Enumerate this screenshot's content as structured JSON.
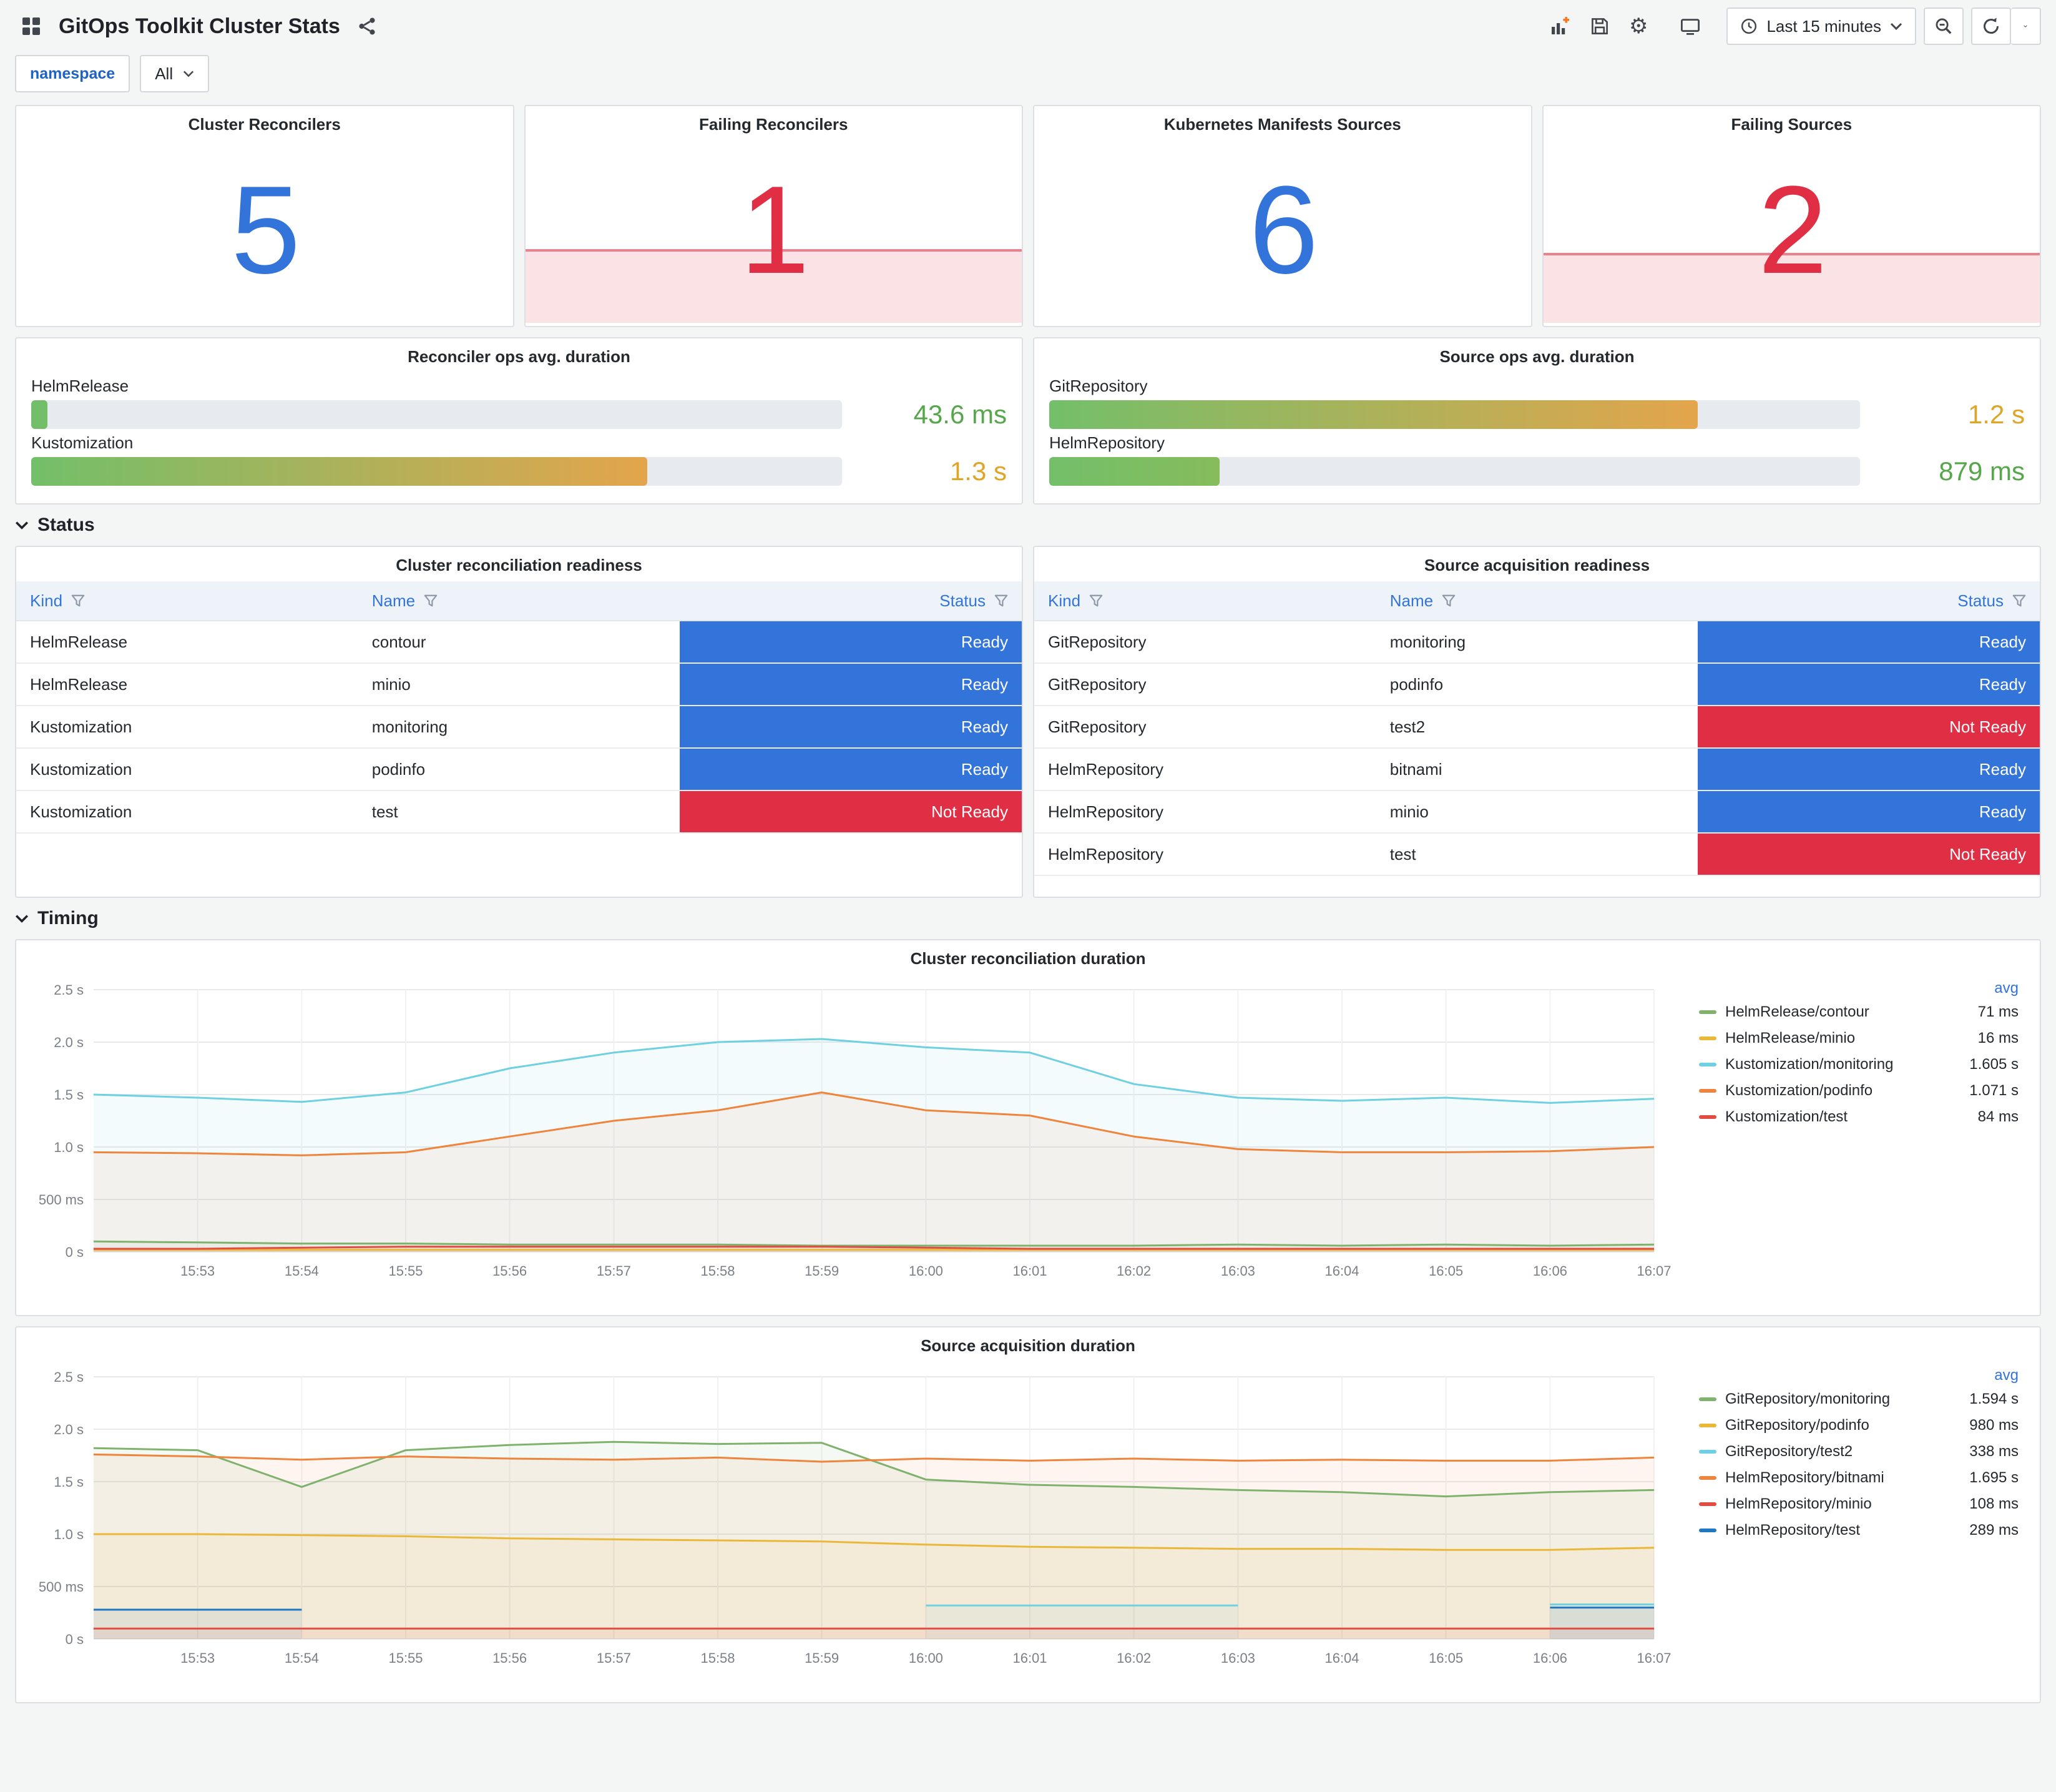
{
  "colors": {
    "blue": "#3274D9",
    "red": "#E02F44",
    "green": "#56A64B",
    "amber": "#E0A426"
  },
  "icons": {
    "settings": "⚙"
  },
  "header": {
    "title": "GitOps Toolkit Cluster Stats",
    "time_picker": "Last 15 minutes"
  },
  "variables": {
    "label": "namespace",
    "value": "All"
  },
  "stat_panels": [
    {
      "title": "Cluster Reconcilers",
      "value": "5",
      "state": "ok",
      "fill_pct": 0
    },
    {
      "title": "Failing Reconcilers",
      "value": "1",
      "state": "alert",
      "fill_pct": 40
    },
    {
      "title": "Kubernetes Manifests Sources",
      "value": "6",
      "state": "ok",
      "fill_pct": 0
    },
    {
      "title": "Failing Sources",
      "value": "2",
      "state": "alert",
      "fill_pct": 38
    }
  ],
  "gauge_panels": [
    {
      "title": "Reconciler ops avg. duration",
      "rows": [
        {
          "label": "HelmRelease",
          "value": "43.6 ms",
          "value_color": "#56A64B",
          "pct": 2,
          "bar_from": "#73BF69",
          "bar_to": "#73BF69"
        },
        {
          "label": "Kustomization",
          "value": "1.3 s",
          "value_color": "#E0A426",
          "pct": 76,
          "bar_from": "#73BF69",
          "bar_to": "#E3A54C"
        }
      ]
    },
    {
      "title": "Source ops avg. duration",
      "rows": [
        {
          "label": "GitRepository",
          "value": "1.2 s",
          "value_color": "#E0A426",
          "pct": 80,
          "bar_from": "#73BF69",
          "bar_to": "#E3A54C"
        },
        {
          "label": "HelmRepository",
          "value": "879 ms",
          "value_color": "#56A64B",
          "pct": 21,
          "bar_from": "#73BF69",
          "bar_to": "#86BC5C"
        }
      ]
    }
  ],
  "sections": [
    {
      "label": "Status"
    },
    {
      "label": "Timing"
    }
  ],
  "tables": [
    {
      "title": "Cluster reconciliation readiness",
      "columns": [
        "Kind",
        "Name",
        "Status"
      ],
      "rows": [
        {
          "kind": "HelmRelease",
          "name": "contour",
          "status": "Ready",
          "state": "ready"
        },
        {
          "kind": "HelmRelease",
          "name": "minio",
          "status": "Ready",
          "state": "ready"
        },
        {
          "kind": "Kustomization",
          "name": "monitoring",
          "status": "Ready",
          "state": "ready"
        },
        {
          "kind": "Kustomization",
          "name": "podinfo",
          "status": "Ready",
          "state": "ready"
        },
        {
          "kind": "Kustomization",
          "name": "test",
          "status": "Not Ready",
          "state": "not-ready"
        }
      ]
    },
    {
      "title": "Source acquisition readiness",
      "columns": [
        "Kind",
        "Name",
        "Status"
      ],
      "rows": [
        {
          "kind": "GitRepository",
          "name": "monitoring",
          "status": "Ready",
          "state": "ready"
        },
        {
          "kind": "GitRepository",
          "name": "podinfo",
          "status": "Ready",
          "state": "ready"
        },
        {
          "kind": "GitRepository",
          "name": "test2",
          "status": "Not Ready",
          "state": "not-ready"
        },
        {
          "kind": "HelmRepository",
          "name": "bitnami",
          "status": "Ready",
          "state": "ready"
        },
        {
          "kind": "HelmRepository",
          "name": "minio",
          "status": "Ready",
          "state": "ready"
        },
        {
          "kind": "HelmRepository",
          "name": "test",
          "status": "Not Ready",
          "state": "not-ready"
        }
      ]
    }
  ],
  "chart_data": [
    {
      "type": "line",
      "title": "Cluster reconciliation duration",
      "legend_header": "avg",
      "ylim": [
        0,
        2.5
      ],
      "grid": true,
      "legend_position": "right",
      "y_ticks": [
        "0 s",
        "500 ms",
        "1.0 s",
        "1.5 s",
        "2.0 s",
        "2.5 s"
      ],
      "x_ticks": [
        "15:53",
        "15:54",
        "15:55",
        "15:56",
        "15:57",
        "15:58",
        "15:59",
        "16:00",
        "16:01",
        "16:02",
        "16:03",
        "16:04",
        "16:05",
        "16:06",
        "16:07"
      ],
      "series": [
        {
          "name": "HelmRelease/contour",
          "avg": "71 ms",
          "color": "#7EB26D",
          "values": [
            0.1,
            0.09,
            0.08,
            0.08,
            0.07,
            0.07,
            0.07,
            0.06,
            0.06,
            0.06,
            0.06,
            0.07,
            0.06,
            0.07,
            0.06,
            0.07
          ]
        },
        {
          "name": "HelmRelease/minio",
          "avg": "16 ms",
          "color": "#EAB839",
          "values": [
            0.02,
            0.02,
            0.02,
            0.02,
            0.02,
            0.02,
            0.02,
            0.02,
            0.02,
            0.02,
            0.02,
            0.02,
            0.02,
            0.02,
            0.02,
            0.02
          ]
        },
        {
          "name": "Kustomization/monitoring",
          "avg": "1.605 s",
          "color": "#6ED0E0",
          "values": [
            1.5,
            1.47,
            1.43,
            1.52,
            1.75,
            1.9,
            2.0,
            2.03,
            1.95,
            1.9,
            1.6,
            1.47,
            1.44,
            1.47,
            1.42,
            1.46
          ]
        },
        {
          "name": "Kustomization/podinfo",
          "avg": "1.071 s",
          "color": "#EF843C",
          "values": [
            0.95,
            0.94,
            0.92,
            0.95,
            1.1,
            1.25,
            1.35,
            1.52,
            1.35,
            1.3,
            1.1,
            0.98,
            0.95,
            0.95,
            0.96,
            1.0
          ]
        },
        {
          "name": "Kustomization/test",
          "avg": "84 ms",
          "color": "#E24D42",
          "values": [
            0.03,
            0.03,
            0.04,
            0.05,
            0.05,
            0.05,
            0.05,
            0.05,
            0.04,
            0.03,
            0.03,
            0.03,
            0.03,
            0.03,
            0.03,
            0.03
          ]
        }
      ]
    },
    {
      "type": "line",
      "title": "Source acquisition duration",
      "legend_header": "avg",
      "ylim": [
        0,
        2.5
      ],
      "grid": true,
      "legend_position": "right",
      "y_ticks": [
        "0 s",
        "500 ms",
        "1.0 s",
        "1.5 s",
        "2.0 s",
        "2.5 s"
      ],
      "x_ticks": [
        "15:53",
        "15:54",
        "15:55",
        "15:56",
        "15:57",
        "15:58",
        "15:59",
        "16:00",
        "16:01",
        "16:02",
        "16:03",
        "16:04",
        "16:05",
        "16:06",
        "16:07"
      ],
      "series": [
        {
          "name": "GitRepository/monitoring",
          "avg": "1.594 s",
          "color": "#7EB26D",
          "values": [
            1.82,
            1.8,
            1.45,
            1.8,
            1.85,
            1.88,
            1.86,
            1.87,
            1.52,
            1.47,
            1.45,
            1.42,
            1.4,
            1.36,
            1.4,
            1.42
          ]
        },
        {
          "name": "GitRepository/podinfo",
          "avg": "980 ms",
          "color": "#EAB839",
          "values": [
            1.0,
            1.0,
            0.99,
            0.98,
            0.96,
            0.95,
            0.94,
            0.93,
            0.9,
            0.88,
            0.87,
            0.86,
            0.86,
            0.85,
            0.85,
            0.87
          ]
        },
        {
          "name": "GitRepository/test2",
          "avg": "338 ms",
          "color": "#6ED0E0",
          "values": [
            null,
            null,
            null,
            null,
            null,
            null,
            null,
            null,
            0.32,
            0.32,
            0.32,
            0.32,
            null,
            null,
            0.33,
            0.33
          ]
        },
        {
          "name": "HelmRepository/bitnami",
          "avg": "1.695 s",
          "color": "#EF843C",
          "values": [
            1.76,
            1.74,
            1.71,
            1.74,
            1.72,
            1.71,
            1.73,
            1.69,
            1.72,
            1.7,
            1.72,
            1.7,
            1.71,
            1.7,
            1.7,
            1.73
          ]
        },
        {
          "name": "HelmRepository/minio",
          "avg": "108 ms",
          "color": "#E24D42",
          "values": [
            0.1,
            0.1,
            0.1,
            0.1,
            0.1,
            0.1,
            0.1,
            0.1,
            0.1,
            0.1,
            0.1,
            0.1,
            0.1,
            0.1,
            0.1,
            0.1
          ]
        },
        {
          "name": "HelmRepository/test",
          "avg": "289 ms",
          "color": "#1F78C1",
          "values": [
            0.28,
            0.28,
            0.28,
            null,
            null,
            null,
            null,
            null,
            null,
            null,
            null,
            null,
            null,
            null,
            0.3,
            0.3
          ]
        }
      ]
    }
  ]
}
